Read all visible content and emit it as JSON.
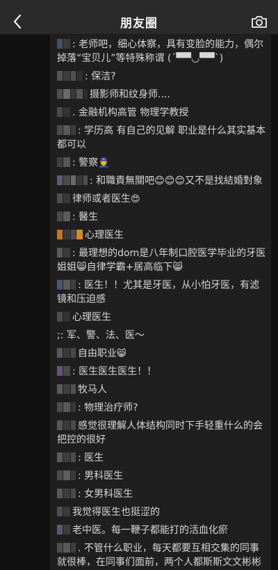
{
  "header": {
    "title": "朋友圈"
  },
  "icons": {
    "back": "chevron-left-icon",
    "camera": "camera-icon"
  },
  "colors": {
    "header_bg": "#2a2a2a",
    "page_bg": "#111111",
    "comment_bg": "#1f1f1f",
    "text": "#d7d7d7"
  },
  "comments": [
    {
      "text": ": 老师吧，细心体察，具有变脸的能力，偶尔掉落“宝贝儿”等特殊称谓 (´▀▀◡▀▀`)",
      "mosaic": [
        "#4a4f63",
        "#3b3b3b"
      ],
      "emoji": ""
    },
    {
      "text": ": 保洁?",
      "mosaic": [
        "#555555",
        "#3d3d3d",
        "#505050",
        "#2f2f2f"
      ],
      "emoji": ""
    },
    {
      "text": "摄影师和纹身师....",
      "mosaic": [
        "#4f4f4f",
        "#6a6a6a",
        "#3a3a3a",
        "#575757",
        "#2d2d2d"
      ],
      "emoji": ""
    },
    {
      "text": ". 金融机构高管  物理学教授",
      "mosaic": [
        "#4a4a4a",
        "#333333"
      ],
      "emoji": ""
    },
    {
      "text": ": 学历高 有自己的见解 职业是什么其实基本都可以",
      "mosaic": [
        "#4b4b4b",
        "#5a5a5a",
        "#3c3c3c"
      ],
      "emoji": ""
    },
    {
      "text": ": 警察",
      "mosaic": [
        "#3f3f3f",
        "#565656"
      ],
      "emoji": "👮"
    },
    {
      "text": ": 和職責無關吧😊😊😊又不是找結婚對象",
      "mosaic": [
        "#5a5f75",
        "#4a4a4a",
        "#6a6a6a",
        "#383838",
        "#4f4f4f"
      ],
      "emoji": ""
    },
    {
      "text": "律师或者医生",
      "mosaic": [
        "#4e4e4e",
        "#383838"
      ],
      "emoji": "😍"
    },
    {
      "text": ": 醫生",
      "mosaic": [
        "#4a4a4a",
        "#5c5c5c"
      ],
      "emoji": ""
    },
    {
      "text": "心理医生",
      "mosaic": [
        "#c4761c",
        "#3a3a3a",
        "#4c4c4c",
        "#d58b2a"
      ],
      "emoji": ""
    },
    {
      "text": ": 最理想的dom是八年制口腔医学毕业的牙医姐姐😸自律学霸+居高临下😸",
      "mosaic": [
        "#5a5a5a",
        "#3a3a3a"
      ],
      "emoji": ""
    },
    {
      "text": ": 医生！！尤其是牙医，从小怕牙医，有滤镜和压迫感",
      "mosaic": [
        "#4c5470",
        "#5c5c5c",
        "#3f3f3f"
      ],
      "emoji": ""
    },
    {
      "text": "心理医生",
      "mosaic": [
        "#4d4d4d",
        "#333333"
      ],
      "emoji": ""
    },
    {
      "text": ";: 军、警、法、医～",
      "mosaic": [],
      "emoji": ""
    },
    {
      "text": "自由职业",
      "mosaic": [
        "#585858",
        "#3a3a3a",
        "#484848"
      ],
      "emoji": "😸"
    },
    {
      "text": ": 医生医生医生！！",
      "mosaic": [
        "#6a4f86",
        "#4a4a4a"
      ],
      "emoji": ""
    },
    {
      "text": "牧马人",
      "mosaic": [
        "#5a5a5a",
        "#3e3e3e",
        "#515151"
      ],
      "emoji": ""
    },
    {
      "text": ": 物理治疗师?",
      "mosaic": [
        "#4c4c4c",
        "#5a5a5a",
        "#373737"
      ],
      "emoji": ""
    },
    {
      "text": "感觉很理解人体结构同时下手轻重什么的会把控的很好",
      "mosaic": [
        "#555555",
        "#3a3a3a",
        "#4b4b4b"
      ],
      "emoji": ""
    },
    {
      "text": ": 医生",
      "mosaic": [
        "#5b5b5b",
        "#3d3d3d",
        "#4d4d4d"
      ],
      "emoji": ""
    },
    {
      "text": ": 男科医生",
      "mosaic": [
        "#4a4a4a",
        "#5f5f5f",
        "#3a3a3a"
      ],
      "emoji": ""
    },
    {
      "text": ": 女男科医生",
      "mosaic": [
        "#575757",
        "#3d3d3d",
        "#4a4a4a"
      ],
      "emoji": ""
    },
    {
      "text": "我觉得医生也挺涩的",
      "mosaic": [
        "#4e4e4e",
        "#3a3a3a"
      ],
      "emoji": ""
    },
    {
      "text": "老中医。每一鞭子都能打的活血化瘀",
      "mosaic": [
        "#545a70",
        "#3c3c3c"
      ],
      "emoji": ""
    },
    {
      "text": ". 不管什么职业，每天都要互相交集的同事就很棒，在同事们面前，两个人都斯斯文文彬彬有礼的，背地里玩很大，反差感Max",
      "mosaic": [
        "#4c4c4c",
        "#5a5a5a",
        "#3e3e3e"
      ],
      "emoji": ""
    }
  ]
}
